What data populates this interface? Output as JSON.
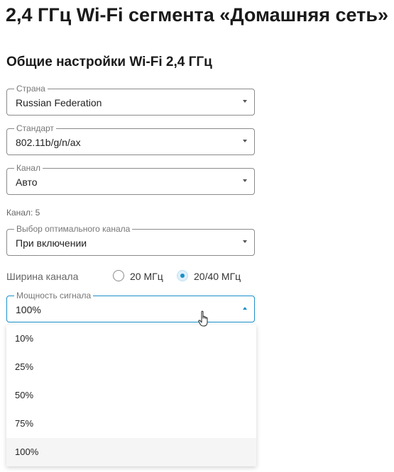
{
  "page": {
    "title": "2,4 ГГц Wi-Fi сегмента «Домашняя сеть»"
  },
  "section": {
    "title": "Общие настройки Wi-Fi 2,4 ГГц"
  },
  "fields": {
    "country": {
      "legend": "Страна",
      "value": "Russian Federation"
    },
    "standard": {
      "legend": "Стандарт",
      "value": "802.11b/g/n/ax"
    },
    "channel": {
      "legend": "Канал",
      "value": "Авто"
    },
    "channel_info": "Канал: 5",
    "optimal_channel": {
      "legend": "Выбор оптимального канала",
      "value": "При включении"
    },
    "bandwidth": {
      "label": "Ширина канала",
      "options": [
        {
          "label": "20 МГц",
          "checked": false
        },
        {
          "label": "20/40 МГц",
          "checked": true
        }
      ]
    },
    "power": {
      "legend": "Мощность сигнала",
      "value": "100%"
    }
  },
  "power_dropdown": {
    "options": [
      "10%",
      "25%",
      "50%",
      "75%",
      "100%"
    ],
    "selected": "100%"
  },
  "colors": {
    "accent": "#1a8fc9",
    "border": "#8a8a8a",
    "selected_bg": "#f5f5f5"
  },
  "icons": {
    "dropdown": "chevron-down-icon",
    "dropdown_open": "chevron-up-icon",
    "cursor": "hand-pointer-icon"
  }
}
